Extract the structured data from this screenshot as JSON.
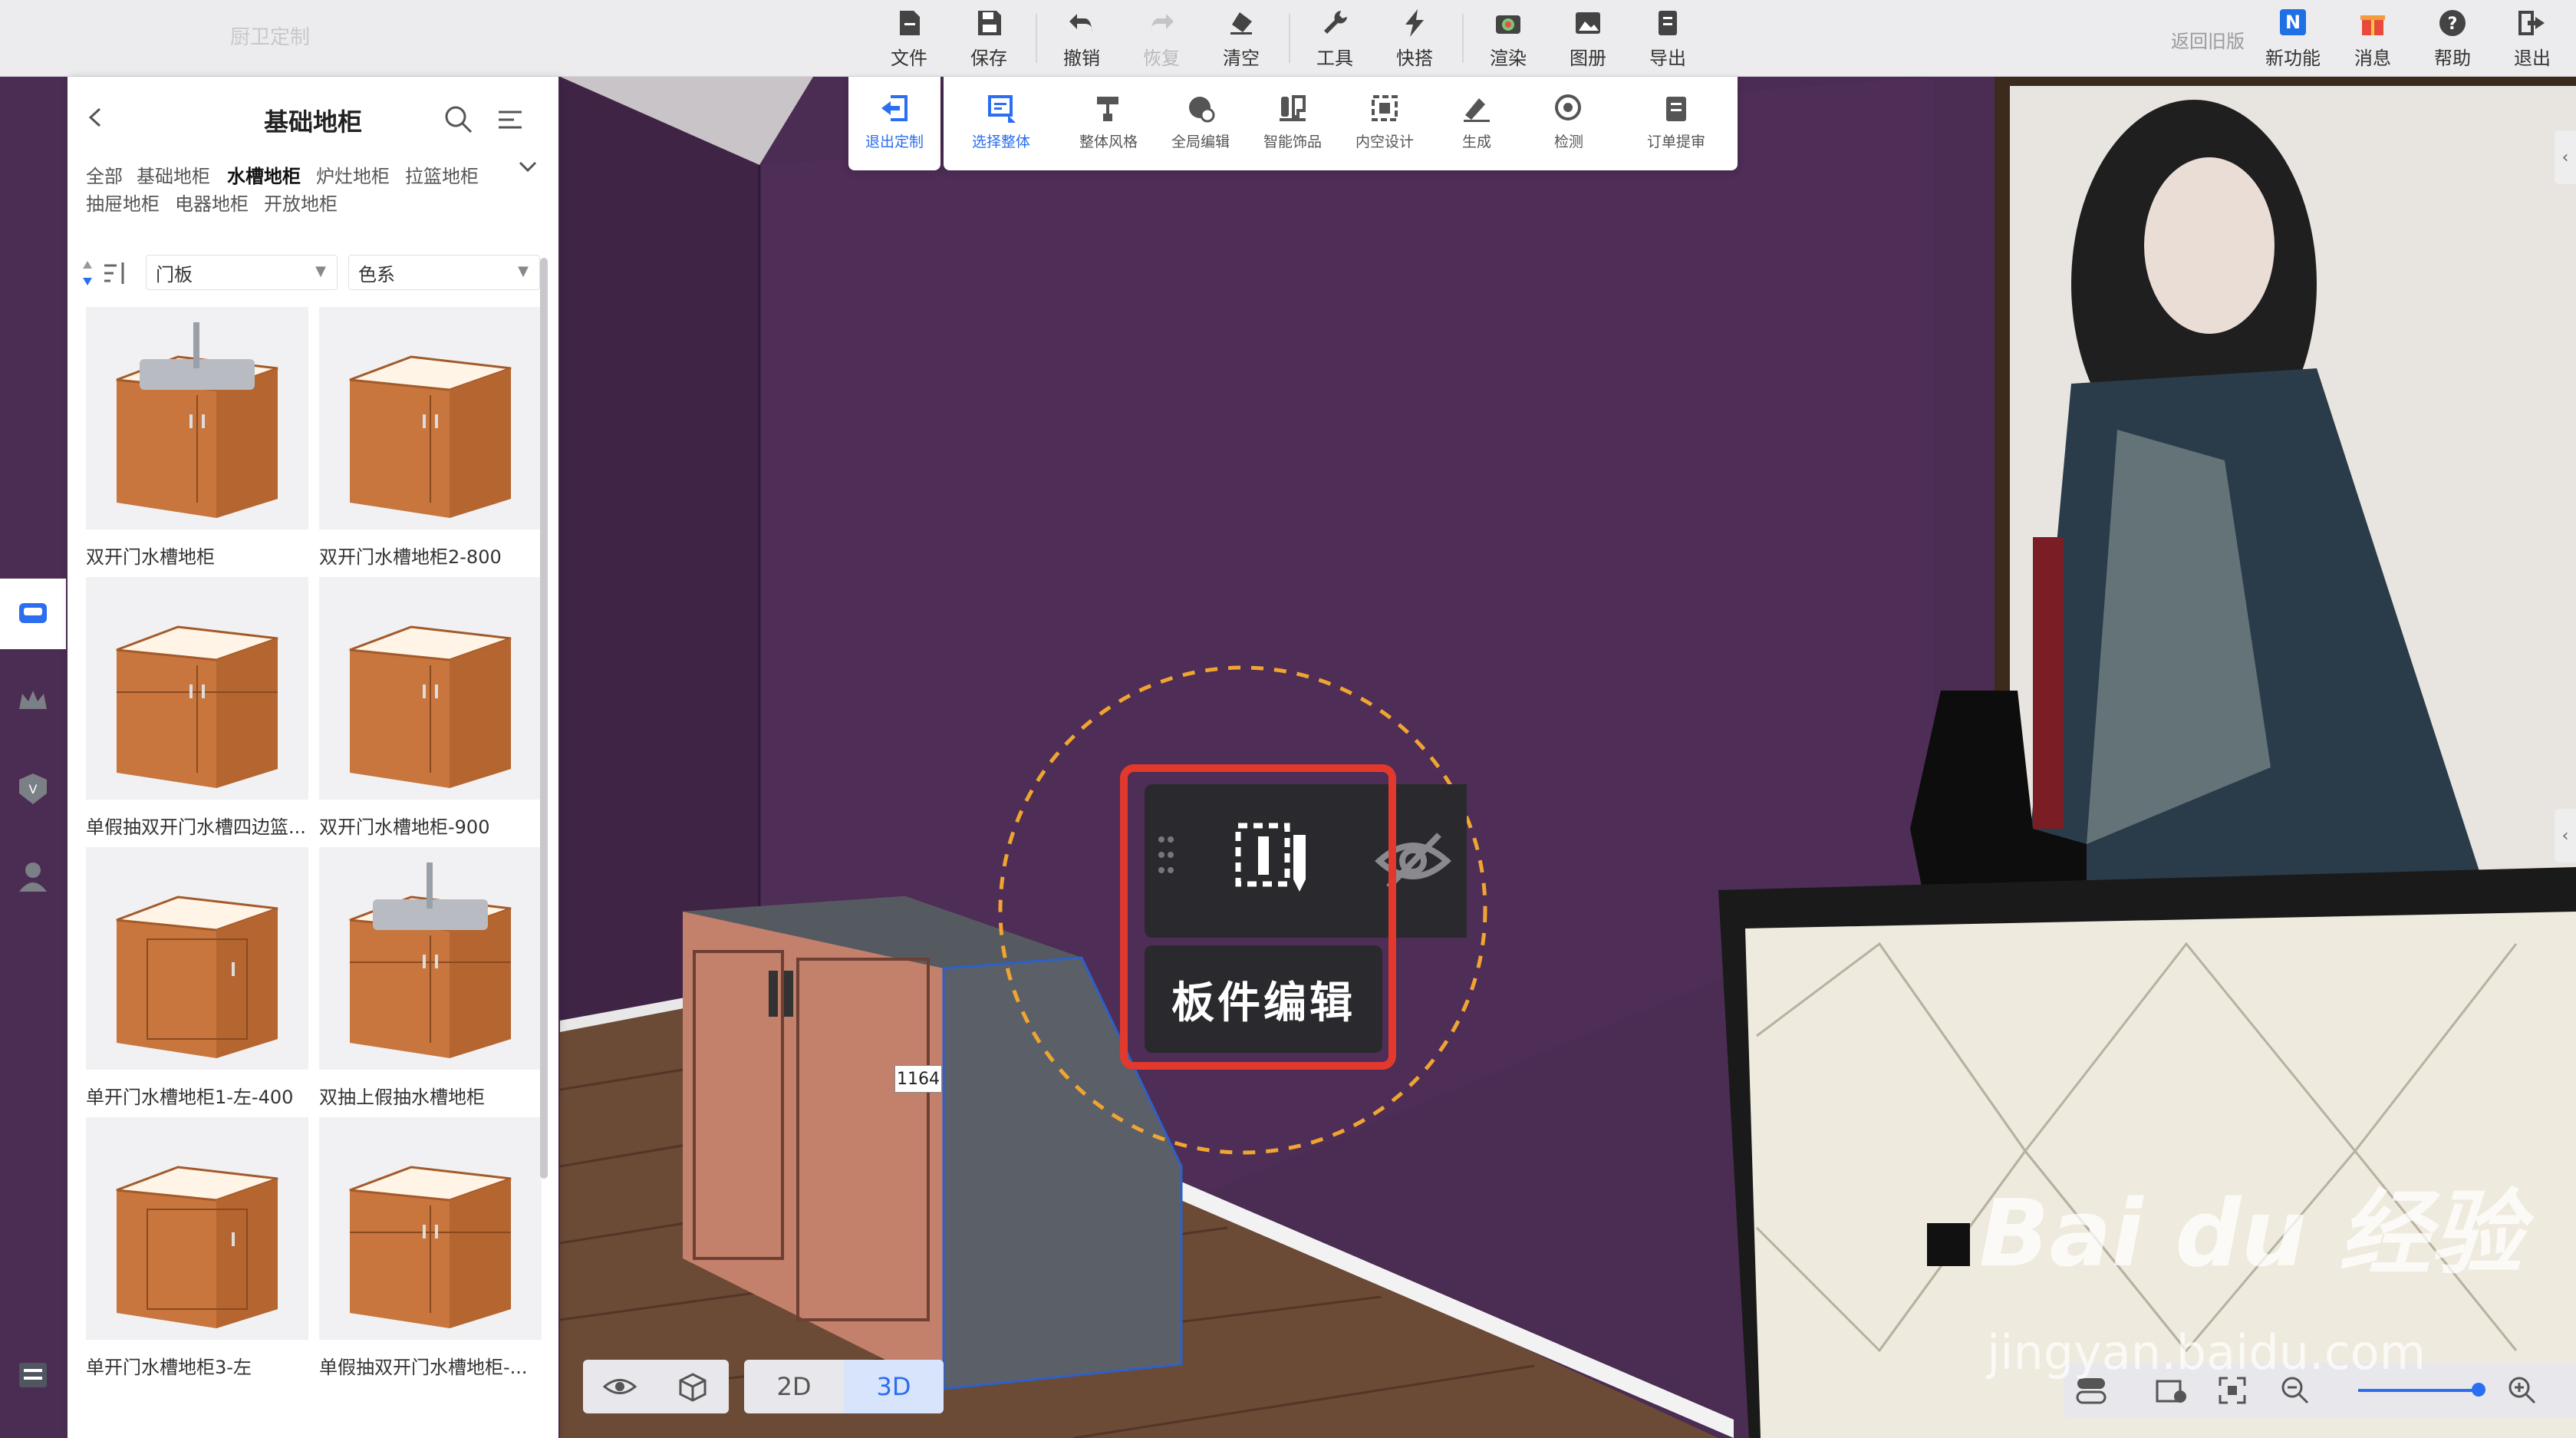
{
  "app": {
    "brand": "厨卫定制"
  },
  "toolbar": {
    "items": [
      {
        "label": "文件",
        "icon": "file-icon"
      },
      {
        "label": "保存",
        "icon": "save-icon"
      },
      {
        "label": "撤销",
        "icon": "undo-icon"
      },
      {
        "label": "恢复",
        "icon": "redo-icon",
        "disabled": true
      },
      {
        "label": "清空",
        "icon": "eraser-icon"
      },
      {
        "label": "工具",
        "icon": "wrench-icon"
      },
      {
        "label": "快搭",
        "icon": "lightning-icon"
      },
      {
        "label": "渲染",
        "icon": "camera-icon"
      },
      {
        "label": "图册",
        "icon": "album-icon"
      },
      {
        "label": "导出",
        "icon": "export-icon"
      }
    ],
    "legacy_label": "返回旧版",
    "right_items": [
      {
        "label": "新功能",
        "icon": "new-feature-icon"
      },
      {
        "label": "消息",
        "icon": "gift-icon"
      },
      {
        "label": "帮助",
        "icon": "help-icon"
      },
      {
        "label": "退出",
        "icon": "logout-icon"
      }
    ],
    "new_badge": "N"
  },
  "subtoolbar": {
    "exit_label": "退出定制",
    "items": [
      {
        "label": "选择整体",
        "icon": "select-whole-icon",
        "active": true
      },
      {
        "label": "整体风格",
        "icon": "paint-roller-icon"
      },
      {
        "label": "全局编辑",
        "icon": "global-edit-icon"
      },
      {
        "label": "智能饰品",
        "icon": "smart-decor-icon"
      },
      {
        "label": "内空设计",
        "icon": "inner-space-icon"
      },
      {
        "label": "生成",
        "icon": "generate-icon"
      },
      {
        "label": "检测",
        "icon": "detect-icon"
      },
      {
        "label": "订单提审",
        "icon": "order-review-icon"
      }
    ]
  },
  "panel": {
    "title": "基础地柜",
    "categories": [
      "全部",
      "基础地柜",
      "水槽地柜",
      "炉灶地柜",
      "拉篮地柜",
      "抽屉地柜",
      "电器地柜",
      "开放地柜"
    ],
    "active_category": "水槽地柜",
    "filters": {
      "material": "门板",
      "color": "色系"
    },
    "products": [
      {
        "name": "双开门水槽地柜",
        "type": "sink-double"
      },
      {
        "name": "双开门水槽地柜2-800",
        "type": "double"
      },
      {
        "name": "单假抽双开门水槽四边篮...",
        "type": "drawer-double"
      },
      {
        "name": "双开门水槽地柜-900",
        "type": "double"
      },
      {
        "name": "单开门水槽地柜1-左-400",
        "type": "single"
      },
      {
        "name": "双抽上假抽水槽地柜",
        "type": "sink-drawers"
      },
      {
        "name": "单开门水槽地柜3-左",
        "type": "single"
      },
      {
        "name": "单假抽双开门水槽地柜-...",
        "type": "drawer-double"
      }
    ]
  },
  "popup": {
    "label": "板件编辑"
  },
  "dimension": "1164",
  "view": {
    "mode_2d": "2D",
    "mode_3d": "3D",
    "active": "3D"
  },
  "zoom": {
    "level": 0.98
  },
  "watermark": {
    "brand": "Bai du 经验",
    "url": "jingyan.baidu.com"
  }
}
